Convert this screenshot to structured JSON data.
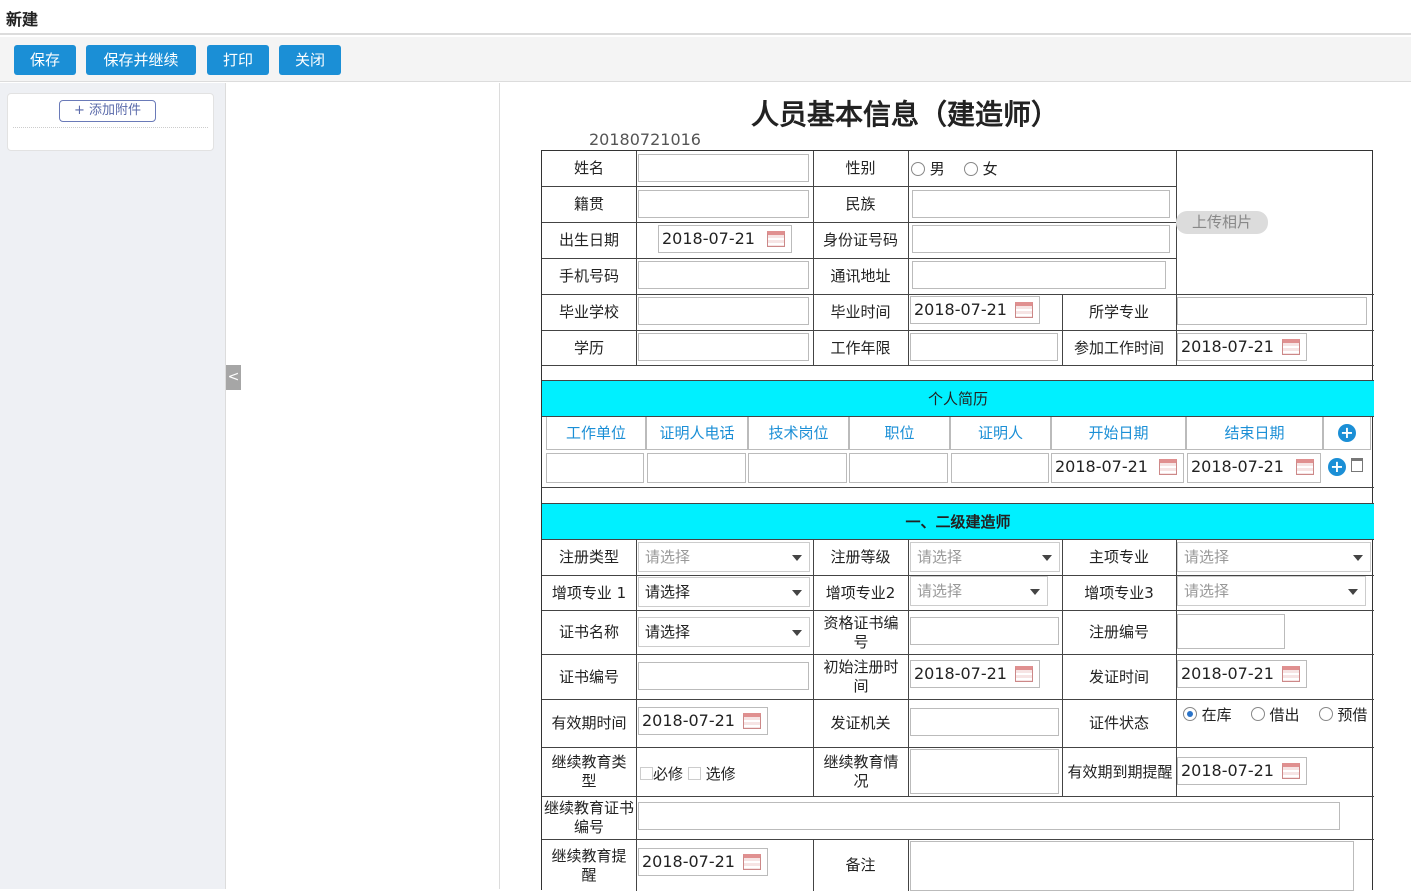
{
  "window_title": "新建",
  "toolbar": {
    "save": "保存",
    "save_continue": "保存并继续",
    "print": "打印",
    "close": "关闭"
  },
  "sidebar": {
    "add_attachment": "+ 添加附件",
    "collapse_icon": "<"
  },
  "form": {
    "title": "人员基本信息（建造师）",
    "number": "20180721016",
    "upload_photo": "上传相片",
    "labels": {
      "name": "姓名",
      "gender": "性别",
      "male": "男",
      "female": "女",
      "native": "籍贯",
      "ethnicity": "民族",
      "birth": "出生日期",
      "id_no": "身份证号码",
      "phone": "手机号码",
      "address": "通讯地址",
      "school": "毕业学校",
      "grad_time": "毕业时间",
      "major": "所学专业",
      "education": "学历",
      "work_years": "工作年限",
      "work_start": "参加工作时间",
      "reg_type": "注册类型",
      "reg_level": "注册等级",
      "main_major": "主项专业",
      "add_major1": "增项专业 1",
      "add_major2": "增项专业2",
      "add_major3": "增项专业3",
      "cert_name": "证书名称",
      "qual_cert_no": "资格证书编号",
      "reg_no": "注册编号",
      "cert_no": "证书编号",
      "init_reg_time": "初始注册时间",
      "issue_time": "发证时间",
      "valid_time": "有效期时间",
      "issuer": "发证机关",
      "cert_status": "证件状态",
      "status_in": "在库",
      "status_out": "借出",
      "status_pre": "预借",
      "cont_edu_type": "继续教育类型",
      "required": "必修",
      "elective": "选修",
      "cont_edu_status": "继续教育情况",
      "expiry_remind": "有效期到期提醒",
      "cont_edu_cert_no": "继续教育证书编号",
      "cont_edu_remind": "继续教育提醒",
      "remark": "备注"
    },
    "dates": {
      "birth": "2018-07-21",
      "grad_time": "2018-07-21",
      "work_start": "2018-07-21",
      "resume_start": "2018-07-21",
      "resume_end": "2018-07-21",
      "init_reg_time": "2018-07-21",
      "issue_time": "2018-07-21",
      "valid_time": "2018-07-21",
      "expiry_remind": "2018-07-21",
      "cont_edu_remind": "2018-07-21"
    },
    "select_placeholder": "请选择",
    "resume": {
      "title": "个人简历",
      "columns": [
        "工作单位",
        "证明人电话",
        "技术岗位",
        "职位",
        "证明人",
        "开始日期",
        "结束日期"
      ]
    },
    "section2_title": "一、二级建造师"
  },
  "colors": {
    "primary": "#1b8fd6",
    "band": "#00f0ff"
  }
}
